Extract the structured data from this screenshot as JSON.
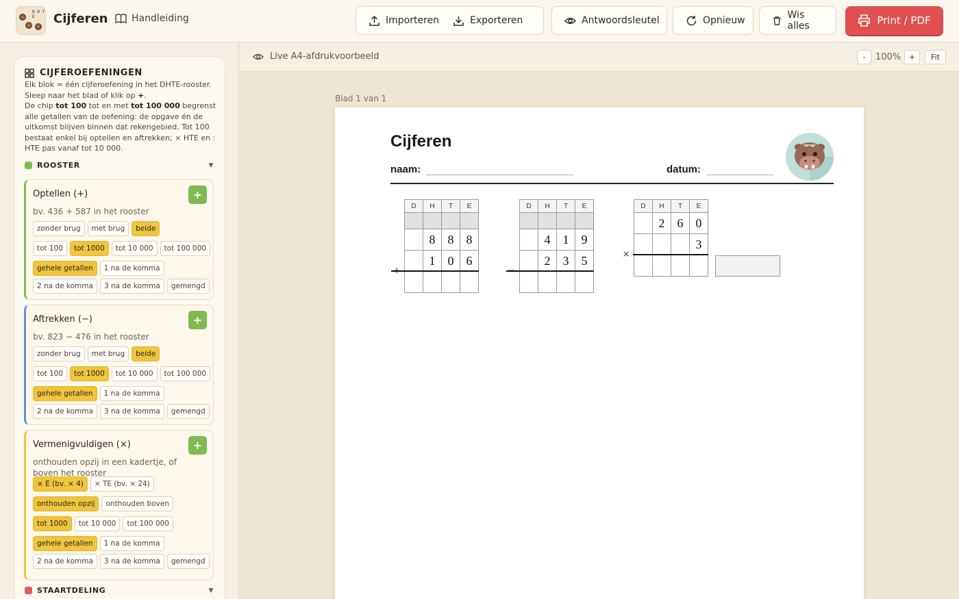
{
  "header": {
    "app_title": "Cijferen",
    "manual": "Handleiding",
    "import": "Importeren",
    "export": "Exporteren",
    "answer_key": "Antwoordsleutel",
    "restart": "Opnieuw",
    "clear_all": "Wis alles",
    "print": "Print / PDF",
    "logo_cells": "D H T E",
    "accent_color": "#e05050"
  },
  "sidebar": {
    "panel_title": "CIJFEROEFENINGEN",
    "intro": {
      "line1": "Elk blok = één cijferoefening in het DHTE-rooster.",
      "line2_pre": "Sleep naar het blad of klik op ",
      "line2_b": "+",
      "line2_post": ".",
      "line3_pre": "De chip ",
      "line3_b1": "tot 100",
      "line3_mid": " tot en met ",
      "line3_b2": "tot 100 000",
      "line3_post": " begrenst alle getallen van de oefening: de opgave én de uitkomst blijven binnen dat rekengebied. Tot 100 bestaat enkel bij optellen en aftrekken; × HTE en : HTE pas vanaf tot 10 000."
    },
    "sections": [
      {
        "label": "ROOSTER",
        "color": "#7dbb4f"
      },
      {
        "label": "STAARTDELING",
        "color": "#e05a5a"
      }
    ],
    "cards": [
      {
        "title": "Optellen (+)",
        "desc": "bv. 436 + 587 in het rooster",
        "color": "#7dbb4f",
        "add": "+",
        "rows": [
          [
            {
              "l": "zonder brug",
              "on": false
            },
            {
              "l": "met brug",
              "on": false
            },
            {
              "l": "beide",
              "on": true
            }
          ],
          [
            {
              "l": "tot 100",
              "on": false
            },
            {
              "l": "tot 1000",
              "on": true
            },
            {
              "l": "tot 10 000",
              "on": false
            },
            {
              "l": "tot 100 000",
              "on": false
            }
          ],
          [
            {
              "l": "gehele getallen",
              "on": true
            },
            {
              "l": "1 na de komma",
              "on": false
            }
          ],
          [
            {
              "l": "2 na de komma",
              "on": false
            },
            {
              "l": "3 na de komma",
              "on": false
            },
            {
              "l": "gemengd",
              "on": false
            }
          ]
        ]
      },
      {
        "title": "Aftrekken (−)",
        "desc": "bv. 823 − 476 in het rooster",
        "color": "#5b8fd6",
        "add": "+",
        "rows": [
          [
            {
              "l": "zonder brug",
              "on": false
            },
            {
              "l": "met brug",
              "on": false
            },
            {
              "l": "beide",
              "on": true
            }
          ],
          [
            {
              "l": "tot 100",
              "on": false
            },
            {
              "l": "tot 1000",
              "on": true
            },
            {
              "l": "tot 10 000",
              "on": false
            },
            {
              "l": "tot 100 000",
              "on": false
            }
          ],
          [
            {
              "l": "gehele getallen",
              "on": true
            },
            {
              "l": "1 na de komma",
              "on": false
            }
          ],
          [
            {
              "l": "2 na de komma",
              "on": false
            },
            {
              "l": "3 na de komma",
              "on": false
            },
            {
              "l": "gemengd",
              "on": false
            }
          ]
        ]
      },
      {
        "title": "Vermenigvuldigen (×)",
        "desc": "onthouden opzij in een kadertje, of boven het rooster",
        "color": "#f0c53d",
        "add": "+",
        "rows": [
          [
            {
              "l": "× E (bv. × 4)",
              "on": true
            },
            {
              "l": "× TE (bv. × 24)",
              "on": false
            }
          ],
          [
            {
              "l": "onthouden opzij",
              "on": true
            },
            {
              "l": "onthouden boven",
              "on": false
            }
          ],
          [
            {
              "l": "tot 1000",
              "on": true
            },
            {
              "l": "tot 10 000",
              "on": false
            },
            {
              "l": "tot 100 000",
              "on": false
            }
          ],
          [
            {
              "l": "gehele getallen",
              "on": true
            },
            {
              "l": "1 na de komma",
              "on": false
            }
          ],
          [
            {
              "l": "2 na de komma",
              "on": false
            },
            {
              "l": "3 na de komma",
              "on": false
            },
            {
              "l": "gemengd",
              "on": false
            }
          ]
        ]
      }
    ]
  },
  "preview": {
    "label": "Live A4-afdrukvoorbeeld",
    "zoom_minus": "-",
    "zoom": "100%",
    "zoom_plus": "+",
    "fit": "Fit",
    "sheet_label": "Blad 1 van 1"
  },
  "worksheet": {
    "title": "Cijferen",
    "name_label": "naam:",
    "date_label": "datum:",
    "columns": [
      "D",
      "H",
      "T",
      "E"
    ],
    "exercises": [
      {
        "operator": "+",
        "top": [
          "",
          "8",
          "8",
          "8"
        ],
        "bottom": [
          "",
          "1",
          "0",
          "6"
        ]
      },
      {
        "operator": "−",
        "top": [
          "",
          "4",
          "1",
          "9"
        ],
        "bottom": [
          "",
          "2",
          "3",
          "5"
        ]
      },
      {
        "operator": "×",
        "top": [
          "",
          "2",
          "6",
          "0"
        ],
        "bottom": [
          "",
          "",
          "",
          "3"
        ]
      }
    ]
  }
}
